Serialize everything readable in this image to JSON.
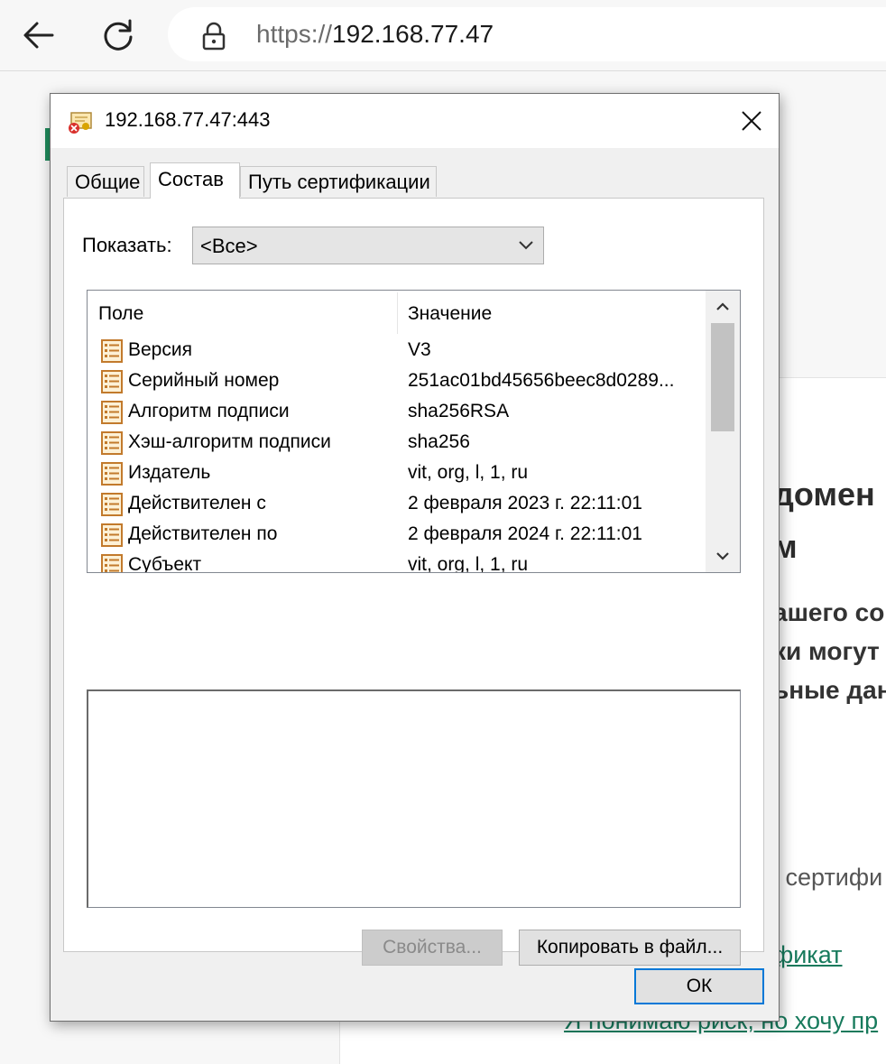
{
  "browser": {
    "back_icon": "arrow-left-icon",
    "reload_icon": "reload-icon",
    "lock_icon": "lock-icon",
    "url_scheme": "https://",
    "url_host": "192.168.77.47"
  },
  "background_page": {
    "heading_line1": "домен",
    "heading_line2": "м",
    "para_line1": "ашего со",
    "para_line2": "ки могут",
    "para_line3": "ьные дан",
    "para_line4": ".",
    "small_text": "і сертифи",
    "link1": "фикат",
    "link2": "Я понимаю риск, но хочу пр",
    "link_color": "#177a5c"
  },
  "dialog": {
    "title": "192.168.77.47:443",
    "title_icon": "certificate-error-icon",
    "close_icon": "close-icon",
    "tabs": [
      {
        "label": "Общие",
        "active": false
      },
      {
        "label": "Состав",
        "active": true
      },
      {
        "label": "Путь сертификации",
        "active": false
      }
    ],
    "show_label": "Показать:",
    "show_value": "<Все>",
    "columns": {
      "field": "Поле",
      "value": "Значение"
    },
    "rows": [
      {
        "field": "Версия",
        "value": "V3"
      },
      {
        "field": "Серийный номер",
        "value": "251ac01bd45656beec8d0289..."
      },
      {
        "field": "Алгоритм подписи",
        "value": "sha256RSA"
      },
      {
        "field": "Хэш-алгоритм подписи",
        "value": "sha256"
      },
      {
        "field": "Издатель",
        "value": "vit, org, l, 1, ru"
      },
      {
        "field": "Действителен с",
        "value": "2 февраля 2023 г. 22:11:01"
      },
      {
        "field": "Действителен по",
        "value": "2 февраля 2024 г. 22:11:01"
      },
      {
        "field": "Субъект",
        "value": "vit, org, l, 1, ru"
      }
    ],
    "buttons": {
      "properties": "Свойства...",
      "copy_to_file": "Копировать в файл...",
      "ok": "ОК"
    },
    "accent": "#0078d7"
  }
}
